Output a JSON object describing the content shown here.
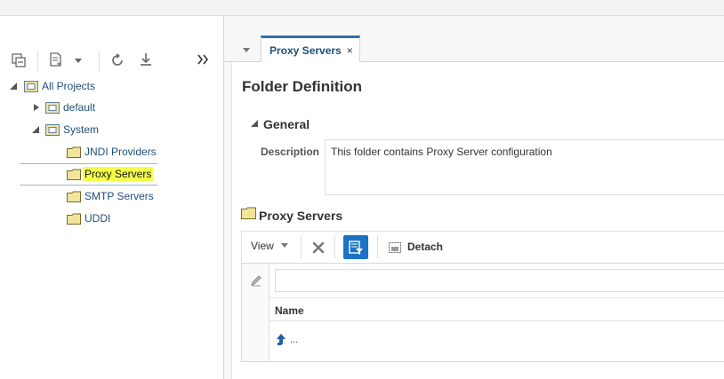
{
  "tree": {
    "root": {
      "label": "All Projects"
    },
    "nodes": [
      {
        "label": "default"
      },
      {
        "label": "System"
      },
      {
        "label": "JNDI Providers"
      },
      {
        "label": "Proxy Servers"
      },
      {
        "label": "SMTP Servers"
      },
      {
        "label": "UDDI"
      }
    ]
  },
  "editor": {
    "tab_label": "Proxy Servers",
    "tab_close": "×",
    "title": "Folder Definition",
    "general_label": "General",
    "description_label": "Description",
    "description_value": "This folder contains Proxy Server configuration",
    "section_title": "Proxy Servers",
    "toolbar": {
      "view_label": "View",
      "detach_label": "Detach"
    },
    "table": {
      "column_name": "Name",
      "row_text": "..."
    }
  },
  "colors": {
    "accent": "#2f6fa8",
    "link": "#1f4e79",
    "selection_highlight": "#f4ff4a",
    "active_button": "#1a73c9"
  }
}
